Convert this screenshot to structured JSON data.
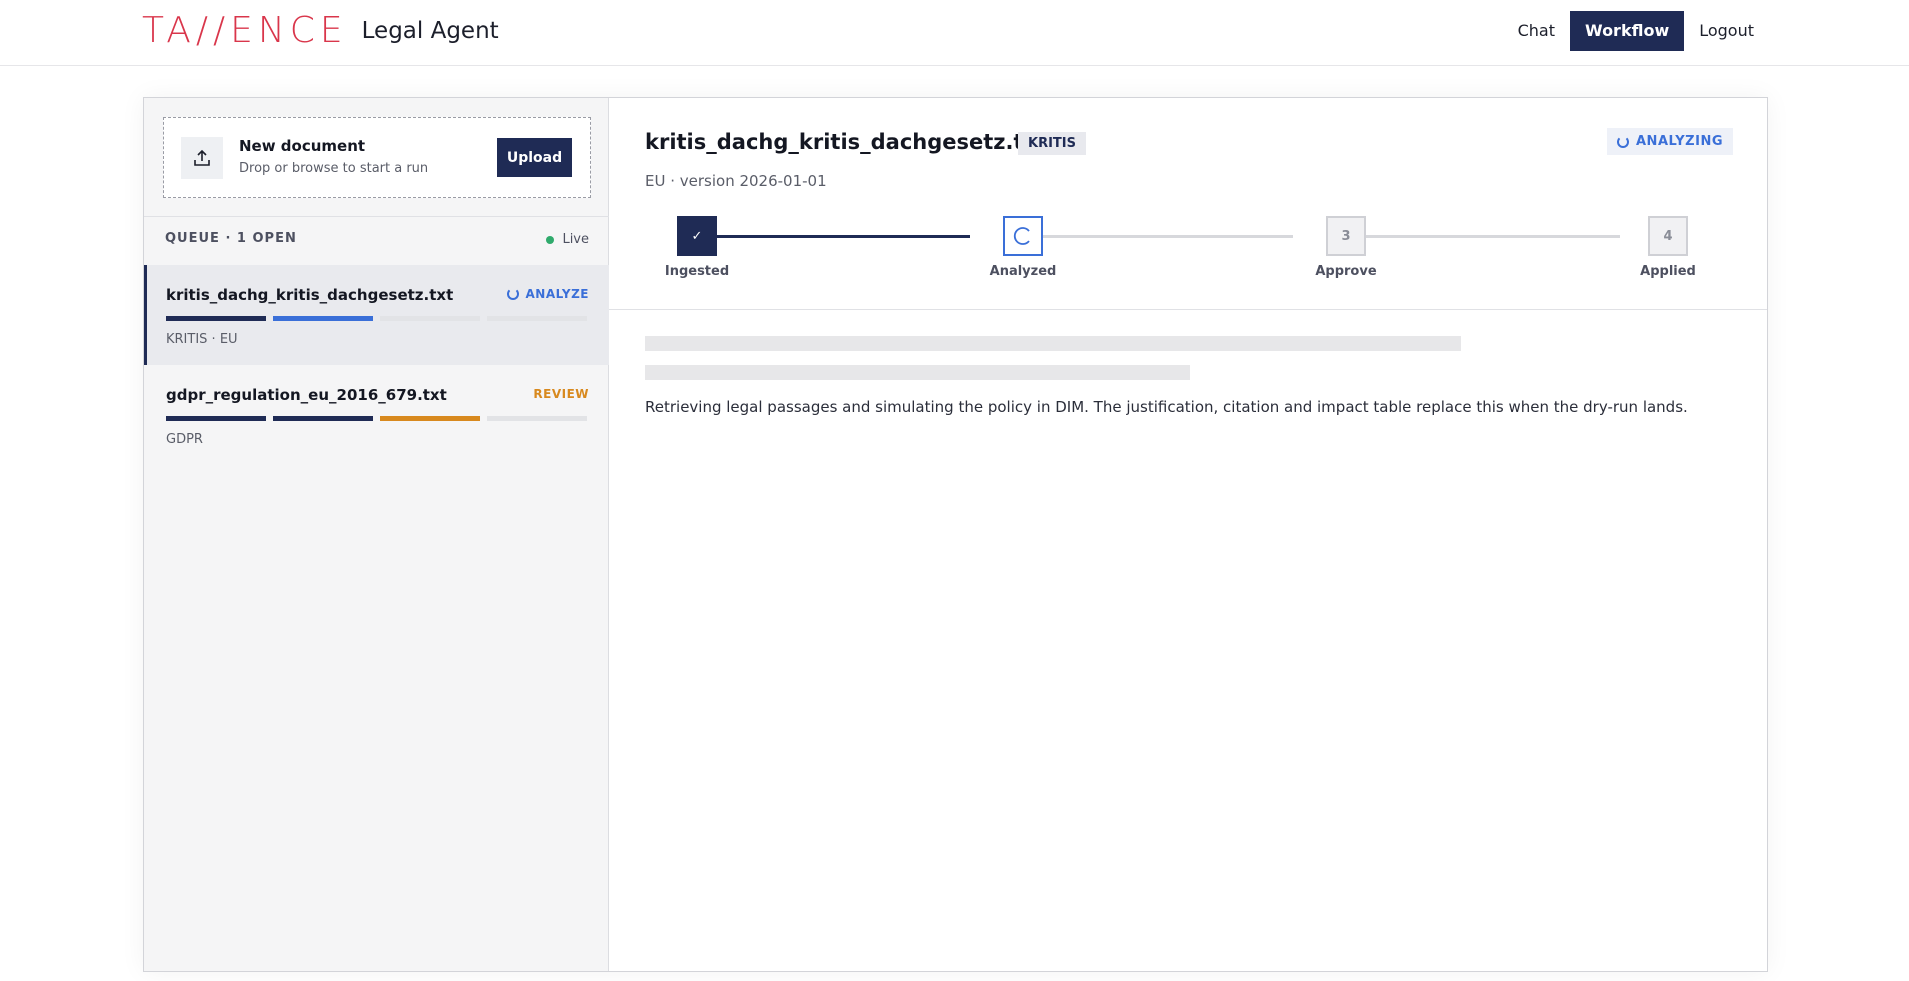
{
  "header": {
    "logo": "TA//ENCE",
    "product": "Legal Agent",
    "nav": [
      {
        "label": "Chat",
        "active": false
      },
      {
        "label": "Workflow",
        "active": true
      },
      {
        "label": "Logout",
        "active": false
      }
    ]
  },
  "upload": {
    "title": "New document",
    "subtitle": "Drop or browse to start a run",
    "button": "Upload",
    "icon": "upload-icon"
  },
  "queue": {
    "title": "QUEUE · 1 OPEN",
    "live_label": "Live",
    "items": [
      {
        "name": "kritis_dachg_kritis_dachgesetz.txt",
        "status": "ANALYZE",
        "meta": "KRITIS · EU",
        "progress": [
          "done",
          "active",
          "todo",
          "todo"
        ]
      },
      {
        "name": "gdpr_regulation_eu_2016_679.txt",
        "status": "REVIEW",
        "meta": "GDPR",
        "progress": [
          "done",
          "done",
          "review",
          "todo"
        ]
      }
    ]
  },
  "detail": {
    "title": "kritis_dachg_kritis_dachgesetz.txt",
    "tag": "KRITIS",
    "subtitle": "EU · version 2026-01-01",
    "status": "ANALYZING",
    "steps": [
      {
        "label": "Ingested",
        "state": "done",
        "marker": "✓"
      },
      {
        "label": "Analyzed",
        "state": "current",
        "marker": ""
      },
      {
        "label": "Approve",
        "state": "todo",
        "marker": "3"
      },
      {
        "label": "Applied",
        "state": "todo",
        "marker": "4"
      }
    ],
    "loading_text": "Retrieving legal passages and simulating the policy in DIM. The justification, citation and impact table replace this when the dry-run lands."
  },
  "colors": {
    "brand": "#d9364b",
    "primary": "#1f2b55",
    "accent": "#3a6fd8",
    "review": "#d8891e",
    "live": "#2faa6c"
  }
}
